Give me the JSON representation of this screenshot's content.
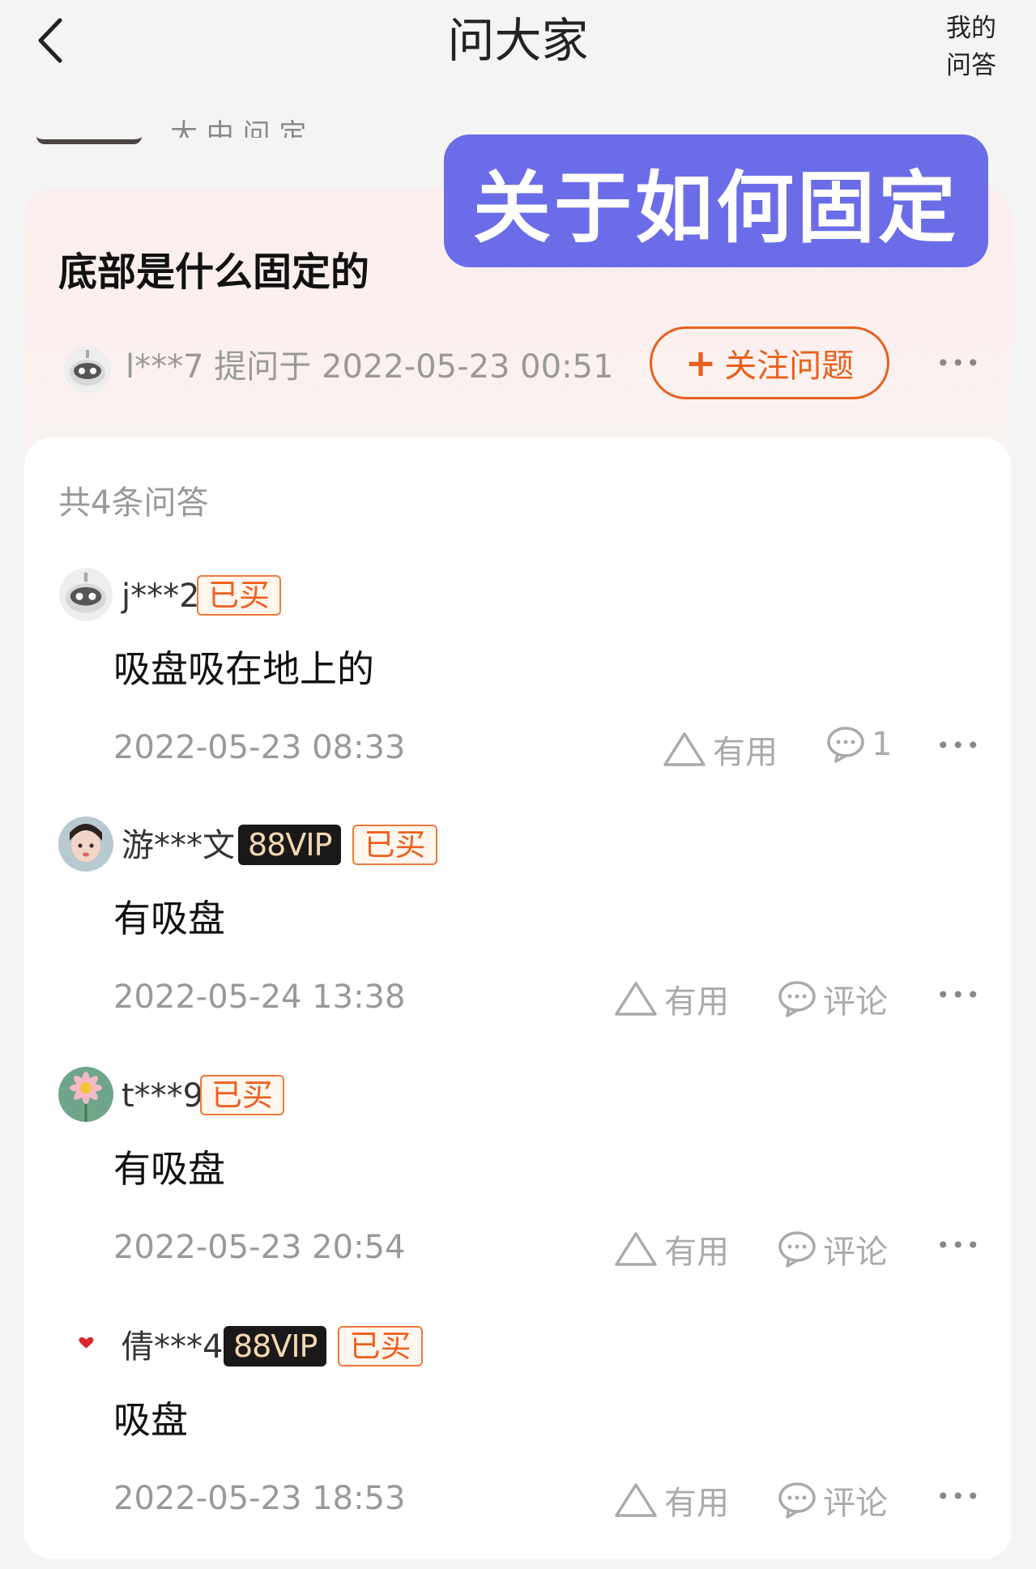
{
  "header": {
    "title": "问大家",
    "my_qa_line1": "我的",
    "my_qa_line2": "问答"
  },
  "prev_snippet": "大 中 问 定",
  "annotation": "关于如何固定",
  "question": {
    "title": "底部是什么固定的",
    "asker": "l***7",
    "asked_prefix": "提问于",
    "asked_time": "2022-05-23 00:51",
    "follow_plus": "+",
    "follow_label": "关注问题",
    "more": "•••"
  },
  "answers_count": "共4条问答",
  "answers": [
    {
      "user": "j***2",
      "vip": "",
      "bought": "已买",
      "text": "吸盘吸在地上的",
      "date": "2022-05-23 08:33",
      "useful": "有用",
      "comment": "1",
      "more": "•••"
    },
    {
      "user": "游***文",
      "vip": "88VIP",
      "bought": "已买",
      "text": "有吸盘",
      "date": "2022-05-24 13:38",
      "useful": "有用",
      "comment": "评论",
      "more": "•••"
    },
    {
      "user": "t***9",
      "vip": "",
      "bought": "已买",
      "text": "有吸盘",
      "date": "2022-05-23 20:54",
      "useful": "有用",
      "comment": "评论",
      "more": "•••"
    },
    {
      "user": "倩***4",
      "vip": "88VIP",
      "bought": "已买",
      "text": "吸盘",
      "date": "2022-05-23 18:53",
      "useful": "有用",
      "comment": "评论",
      "more": "•••"
    }
  ],
  "colors": {
    "accent": "#e8611f",
    "annotation_bg": "#6b6de8",
    "vip_bg": "#1a1818",
    "muted": "#999999"
  },
  "icons": [
    "back-arrow-icon",
    "robot-avatar-icon",
    "thumbs-up-triangle-icon",
    "comment-bubble-icon",
    "more-dots-icon",
    "heart-icon"
  ]
}
